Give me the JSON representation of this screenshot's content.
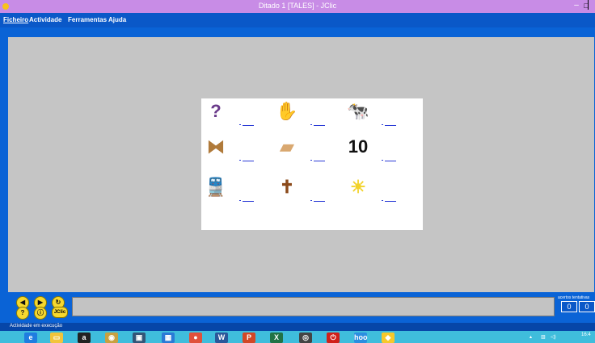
{
  "window": {
    "title": "Ditado 1 [TALES] - JClic",
    "minimize_glyph": "–",
    "maximize_glyph": "□"
  },
  "menu": {
    "items": [
      "Ficheiro",
      "Actividade",
      "Ferramentas",
      "Ajuda"
    ]
  },
  "activity": {
    "cells": [
      {
        "icon": "question-mark-figure-icon",
        "glyph": "?",
        "color": "#6a3a8a"
      },
      {
        "icon": "hand-icon",
        "glyph": "✋",
        "color": "#e6b088"
      },
      {
        "icon": "cow-icon",
        "glyph": "🐄",
        "color": "#8b4a2b"
      },
      {
        "icon": "knot-rope-icon",
        "glyph": "⧓",
        "color": "#b07a3a"
      },
      {
        "icon": "bread-loaf-icon",
        "glyph": "▰",
        "color": "#d9a870"
      },
      {
        "icon": "number-ten-icon",
        "glyph": "10",
        "color": "#111111"
      },
      {
        "icon": "train-icon",
        "glyph": "🚆",
        "color": "#3a56a8"
      },
      {
        "icon": "cross-icon",
        "glyph": "✝",
        "color": "#8b4a1a"
      },
      {
        "icon": "sun-icon",
        "glyph": "☀",
        "color": "#f2d22a"
      }
    ]
  },
  "navigation": {
    "prev": "◀",
    "next": "▶",
    "reload": "↻",
    "help": "?",
    "info": "ⓘ",
    "jclic": "JClic"
  },
  "counters": {
    "label": "acertos tentativas",
    "right": "0",
    "tries": "0"
  },
  "status": {
    "text": "Actividade em execução"
  },
  "taskbar": {
    "items": [
      {
        "name": "ie-icon",
        "glyph": "e",
        "color": "#1f7de0"
      },
      {
        "name": "file-explorer-icon",
        "glyph": "▭",
        "color": "#f2c43a"
      },
      {
        "name": "amazon-icon",
        "glyph": "a",
        "color": "#222222"
      },
      {
        "name": "app-icon-4",
        "glyph": "◉",
        "color": "#c8a040"
      },
      {
        "name": "app-icon-5",
        "glyph": "▣",
        "color": "#335577"
      },
      {
        "name": "app-icon-6",
        "glyph": "▦",
        "color": "#2a7ad6"
      },
      {
        "name": "chrome-icon",
        "glyph": "●",
        "color": "#e0503a"
      },
      {
        "name": "word-icon",
        "glyph": "W",
        "color": "#2b579a"
      },
      {
        "name": "powerpoint-icon",
        "glyph": "P",
        "color": "#d24726"
      },
      {
        "name": "excel-icon",
        "glyph": "X",
        "color": "#217346"
      },
      {
        "name": "app-icon-11",
        "glyph": "◎",
        "color": "#444444"
      },
      {
        "name": "power-icon",
        "glyph": "⏻",
        "color": "#d0201a"
      },
      {
        "name": "hoo-icon",
        "glyph": "hoo",
        "color": "#2b8ee0"
      },
      {
        "name": "jclic-task-icon",
        "glyph": "◆",
        "color": "#f6c82a"
      }
    ],
    "clock": "16:4"
  },
  "colors": {
    "titlebar": "#c88ce6",
    "chrome": "#0a63d6",
    "stage": "#c5c5c5",
    "taskbar": "#3fbddc"
  }
}
